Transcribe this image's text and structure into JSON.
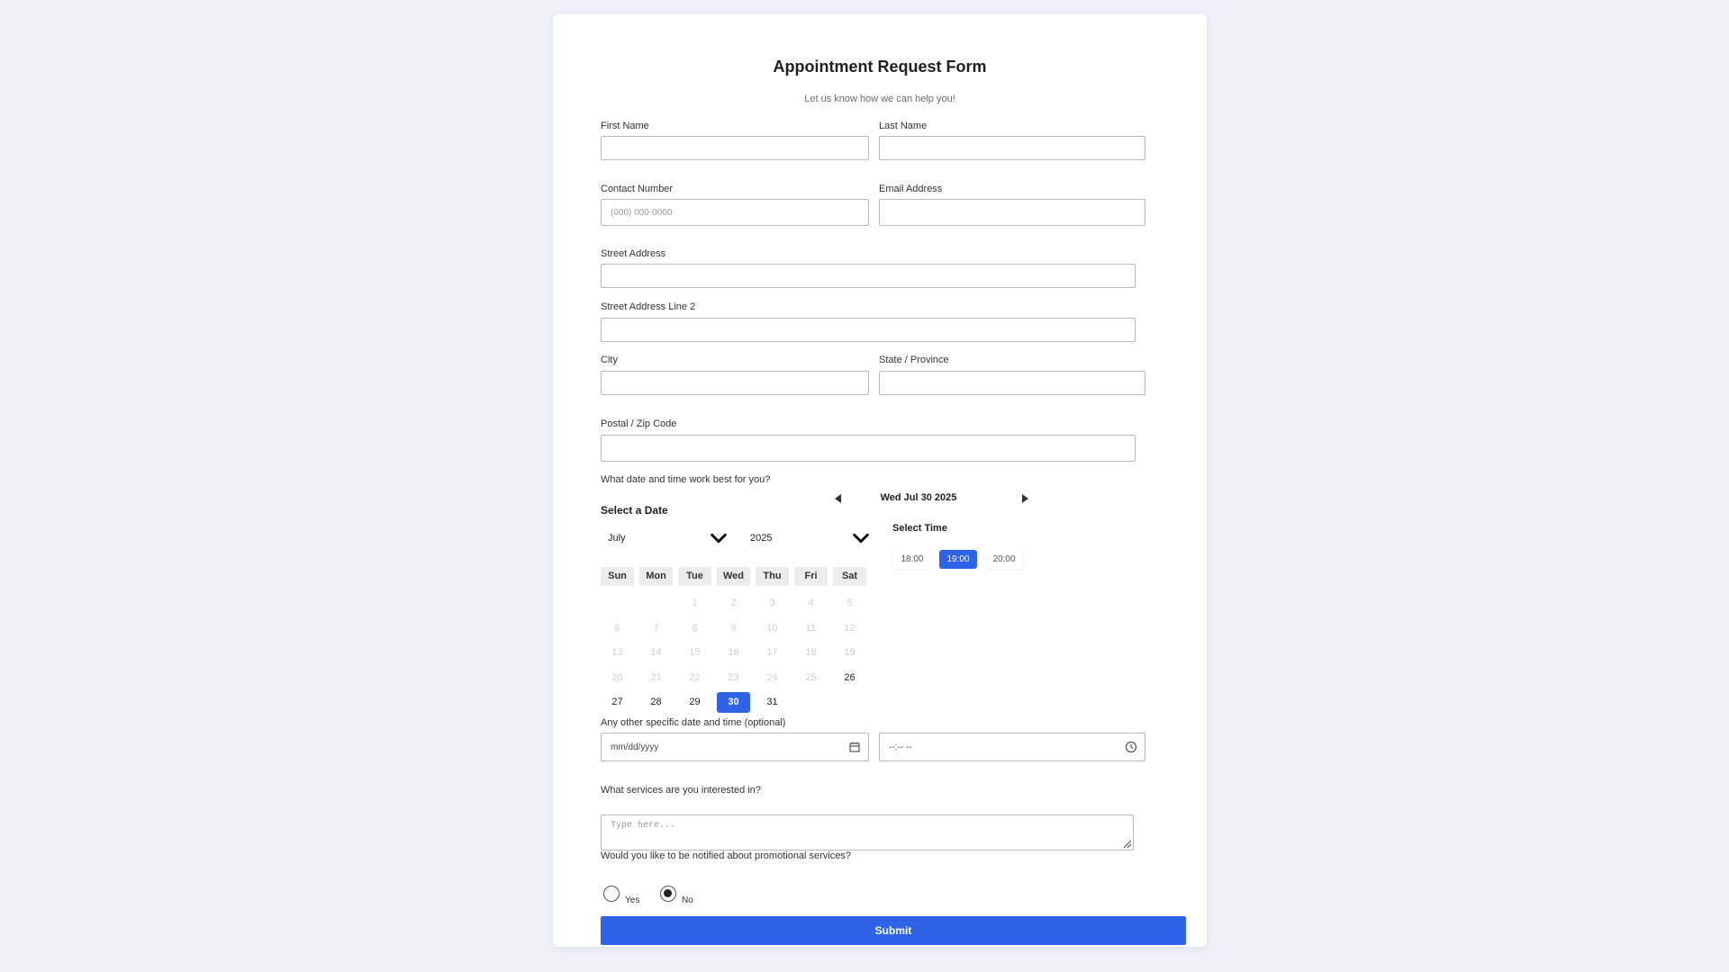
{
  "form": {
    "title": "Appointment Request Form",
    "subtitle": "Let us know how we can help you!"
  },
  "fields": {
    "first_name": {
      "label": "First Name",
      "value": ""
    },
    "last_name": {
      "label": "Last Name",
      "value": ""
    },
    "contact_number": {
      "label": "Contact Number",
      "placeholder": "(000) 000-0000",
      "value": ""
    },
    "email": {
      "label": "Email Address",
      "value": ""
    },
    "street": {
      "label": "Street Address",
      "value": ""
    },
    "street2": {
      "label": "Street Address Line 2",
      "value": ""
    },
    "city": {
      "label": "City",
      "value": ""
    },
    "state": {
      "label": "State / Province",
      "value": ""
    },
    "postal": {
      "label": "Postal / Zip Code",
      "value": ""
    }
  },
  "scheduling": {
    "question": "What date and time work best for you?",
    "select_date_title": "Select a Date",
    "month": "July",
    "year": "2025",
    "weekdays": [
      "Sun",
      "Mon",
      "Tue",
      "Wed",
      "Thu",
      "Fri",
      "Sat"
    ],
    "weeks": [
      [
        "",
        "",
        "1",
        "2",
        "3",
        "4",
        "5"
      ],
      [
        "6",
        "7",
        "8",
        "9",
        "10",
        "11",
        "12"
      ],
      [
        "13",
        "14",
        "15",
        "16",
        "17",
        "18",
        "19"
      ],
      [
        "20",
        "21",
        "22",
        "23",
        "24",
        "25",
        "26"
      ],
      [
        "27",
        "28",
        "29",
        "30",
        "31",
        "",
        ""
      ]
    ],
    "available_days": [
      "26",
      "27",
      "28",
      "29",
      "30",
      "31"
    ],
    "selected_day": "30",
    "selected_date_label": "Wed Jul 30 2025",
    "select_time_title": "Select Time",
    "time_slots": [
      "18:00",
      "19:00",
      "20:00"
    ],
    "selected_time": "19:00"
  },
  "other_datetime": {
    "label": "Any other specific date and time (optional)",
    "date_placeholder": "mm/dd/yyyy",
    "time_placeholder": "--:-- --"
  },
  "services": {
    "label": "What services are you interested in?",
    "placeholder": "Type here..."
  },
  "promo": {
    "question": "Would you like to be notified about promotional services?",
    "options": [
      "Yes",
      "No"
    ],
    "selected": "No"
  },
  "submit_label": "Submit",
  "colors": {
    "accent": "#2e63e8",
    "background": "#eef1f8",
    "card": "#ffffff"
  }
}
